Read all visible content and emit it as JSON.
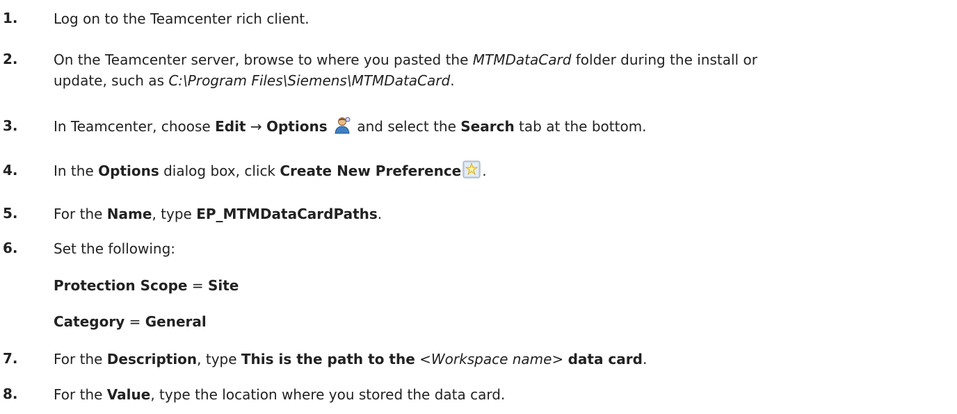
{
  "steps": [
    {
      "num": "1.",
      "t1": "Log on to the Teamcenter rich client."
    },
    {
      "num": "2.",
      "t1": "On the Teamcenter server, browse to where you pasted the ",
      "i1": "MTMDataCard",
      "t2": " folder during the install or",
      "t3": "update, such as ",
      "i2": "C:\\Program Files\\Siemens\\MTMDataCard",
      "t4": "."
    },
    {
      "num": "3.",
      "t1": "In Teamcenter, choose ",
      "b1": "Edit",
      "t2": " → ",
      "b2": "Options",
      "t3": " and select the ",
      "b3": "Search",
      "t4": " tab at the bottom."
    },
    {
      "num": "4.",
      "t1": "In the ",
      "b1": "Options",
      "t2": " dialog box, click ",
      "b2": "Create New Preference",
      "t3": "."
    },
    {
      "num": "5.",
      "t1": "For the ",
      "b1": "Name",
      "t2": ", type ",
      "b2": "EP_MTMDataCardPaths",
      "t3": "."
    },
    {
      "num": "6.",
      "t1": "Set the following:"
    },
    {
      "num": "7.",
      "t1": "For the ",
      "b1": "Description",
      "t2": ", type ",
      "b2": "This is the path to the",
      "t3": " ",
      "i1": "<Workspace name>",
      "t4": " ",
      "b3": "data card",
      "t5": "."
    },
    {
      "num": "8.",
      "t1": "For the ",
      "b1": "Value",
      "t2": ", type the location where you stored the data card."
    }
  ],
  "settings": [
    {
      "label": "Protection Scope",
      "eq": " = ",
      "value": "Site"
    },
    {
      "label": "Category",
      "eq": " = ",
      "value": "General"
    }
  ],
  "icons": {
    "options_icon": "user-options-icon",
    "create_preference_icon": "create-new-preference-icon"
  }
}
